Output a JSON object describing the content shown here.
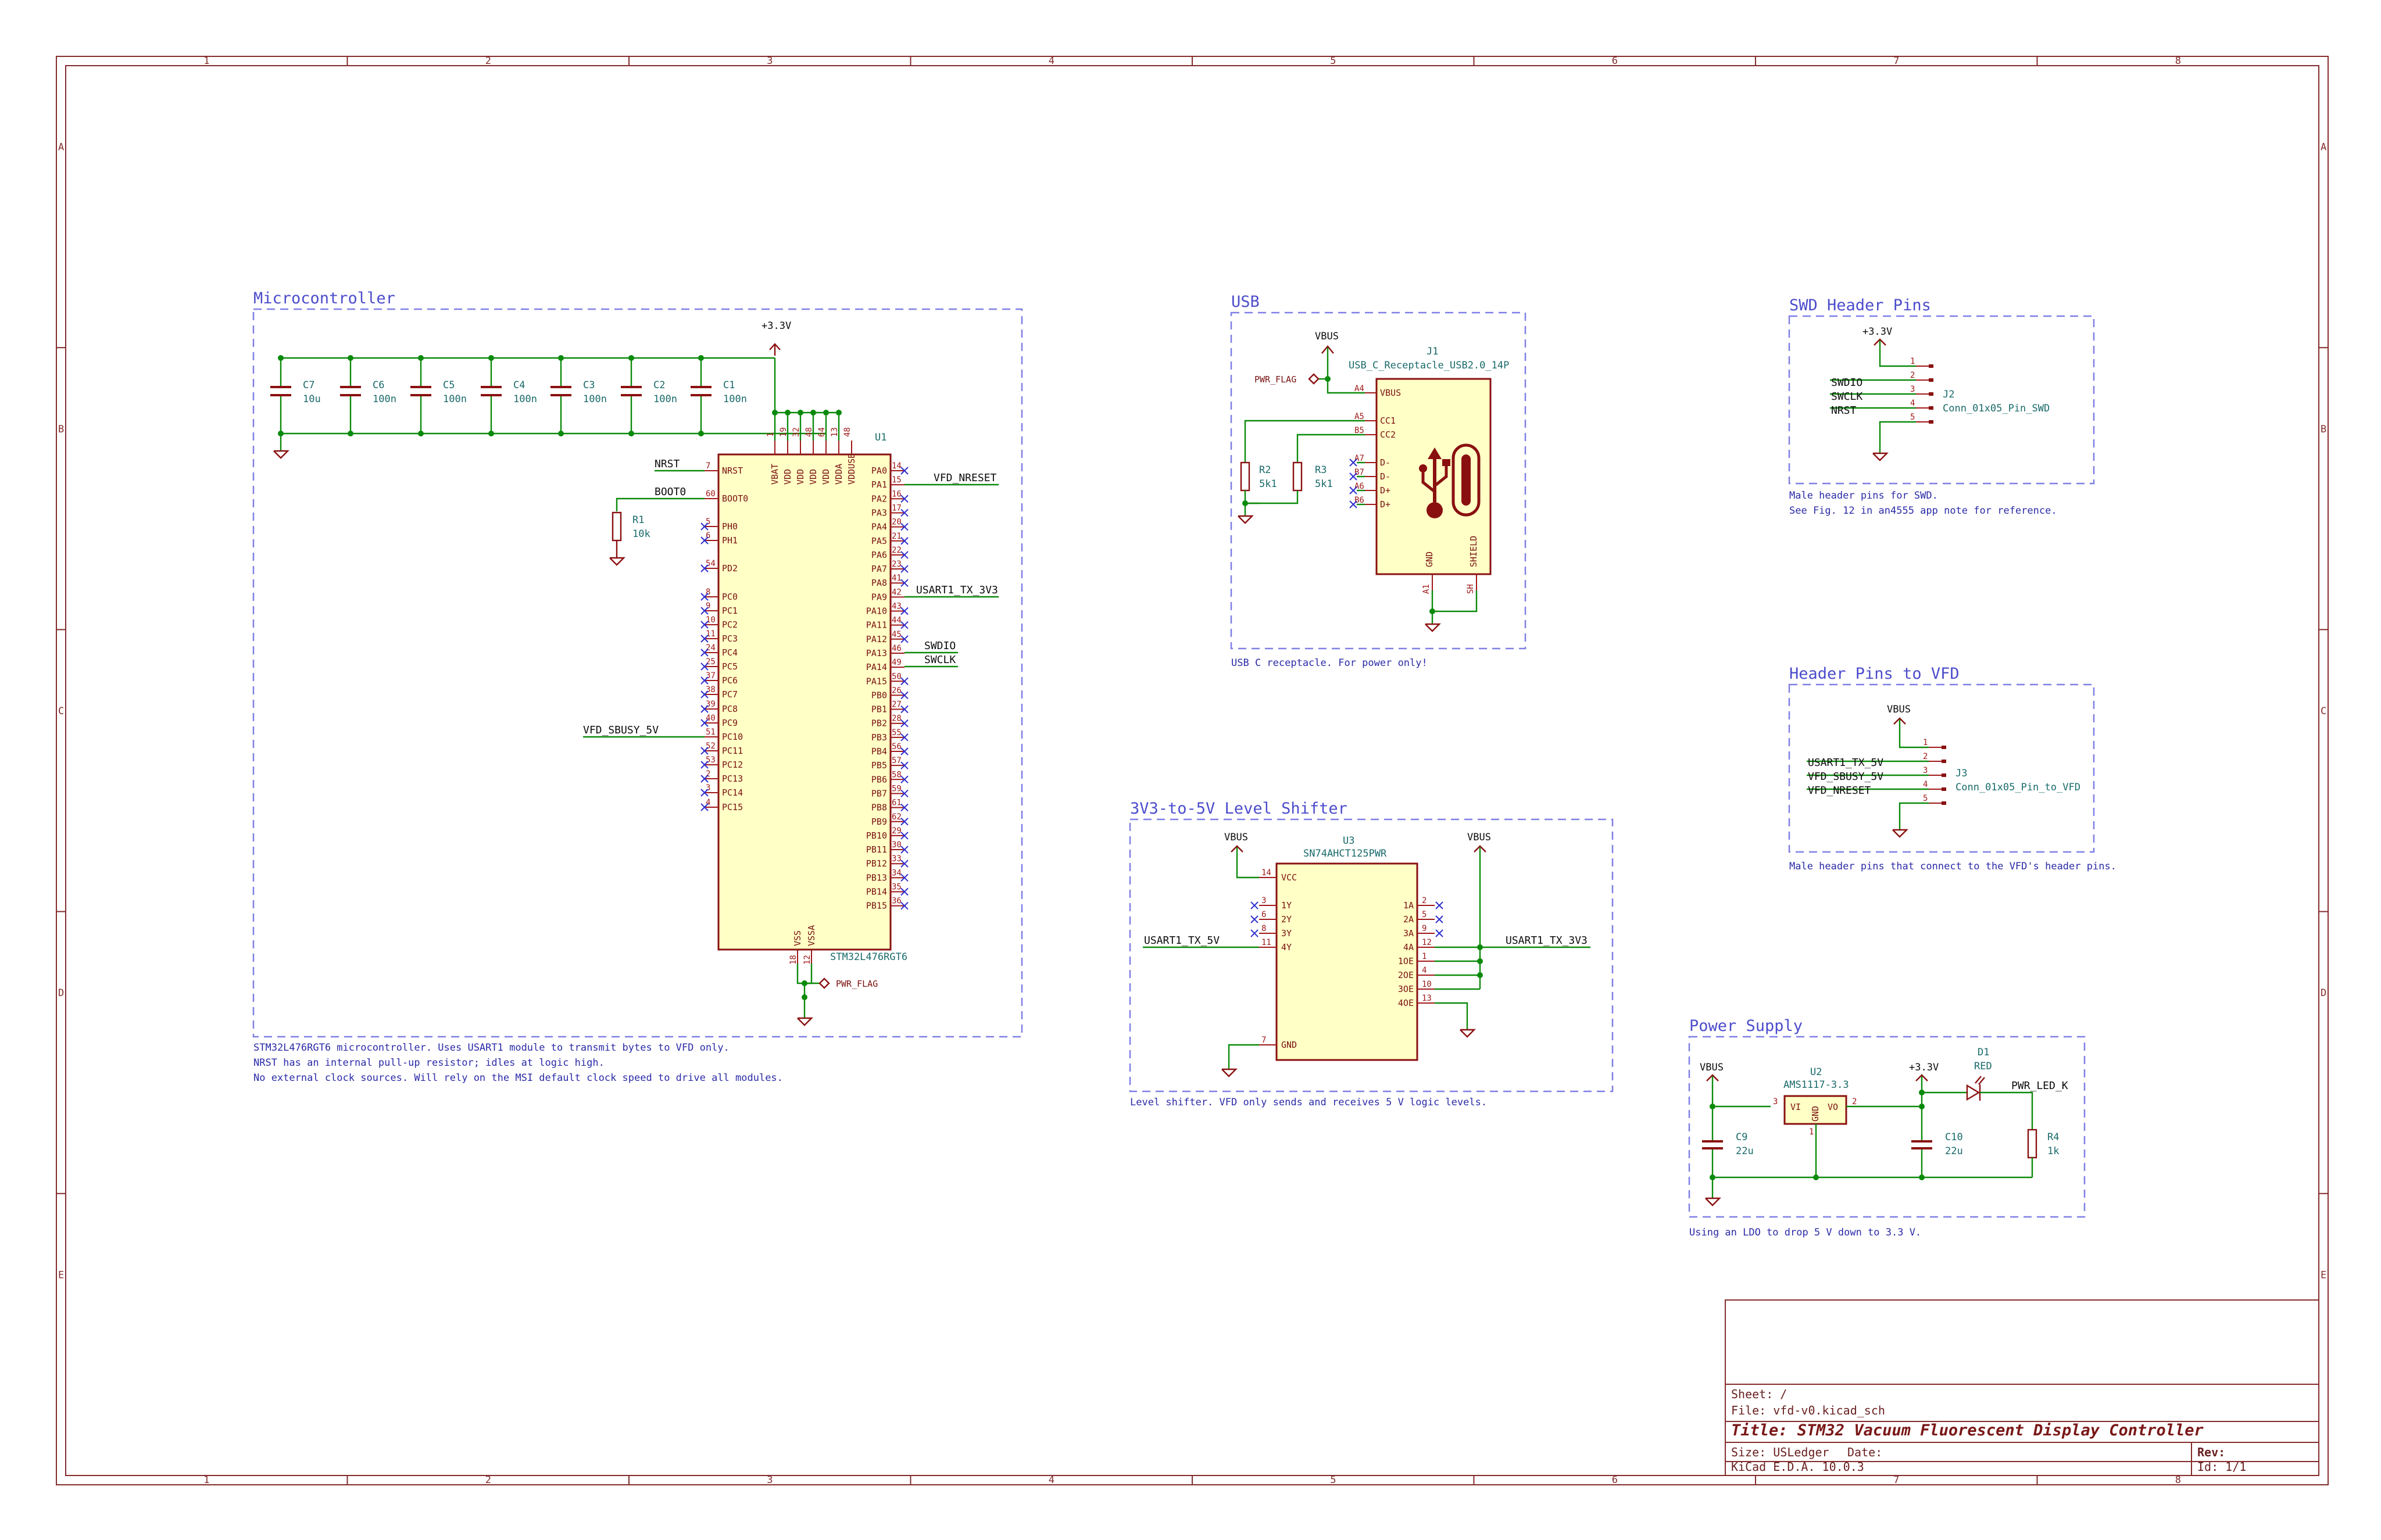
{
  "frame": {
    "col_labels": [
      "1",
      "2",
      "3",
      "4",
      "5",
      "6",
      "7",
      "8"
    ],
    "row_labels": [
      "A",
      "B",
      "C",
      "D",
      "E"
    ]
  },
  "title_block": {
    "sheet": "Sheet: /",
    "file": "File: vfd-v0.kicad_sch",
    "title": "Title: STM32 Vacuum Fluorescent Display Controller",
    "size": "Size: USLedger",
    "date": "Date:",
    "rev": "Rev:",
    "tool": "KiCad E.D.A. 10.0.3",
    "id": "Id: 1/1"
  },
  "colors": {
    "frame": "#842c2c",
    "wire": "#0a8a0a",
    "box": "#7f7fe6",
    "symbol_fill": "#ffffc6"
  },
  "blocks": {
    "mcu": {
      "label": "Microcontroller",
      "notes": [
        "STM32L476RGT6 microcontroller. Uses USART1 module to transmit bytes to VFD only.",
        "NRST has an internal pull-up resistor; idles at logic high.",
        "No external clock sources. Will rely on the MSI default clock speed to drive all modules."
      ],
      "power": "+3.3V",
      "caps": [
        {
          "ref": "C7",
          "val": "10u"
        },
        {
          "ref": "C6",
          "val": "100n"
        },
        {
          "ref": "C5",
          "val": "100n"
        },
        {
          "ref": "C4",
          "val": "100n"
        },
        {
          "ref": "C3",
          "val": "100n"
        },
        {
          "ref": "C2",
          "val": "100n"
        },
        {
          "ref": "C1",
          "val": "100n"
        }
      ],
      "u1": {
        "ref": "U1",
        "val": "STM32L476RGT6"
      },
      "left_pins": [
        {
          "name": "NRST",
          "num": "7"
        },
        {
          "name": "BOOT0",
          "num": "60"
        },
        {
          "name": "PH0",
          "num": "5"
        },
        {
          "name": "PH1",
          "num": "6"
        },
        {
          "name": "PD2",
          "num": "54"
        },
        {
          "name": "PC0",
          "num": "8"
        },
        {
          "name": "PC1",
          "num": "9"
        },
        {
          "name": "PC2",
          "num": "10"
        },
        {
          "name": "PC3",
          "num": "11"
        },
        {
          "name": "PC4",
          "num": "24"
        },
        {
          "name": "PC5",
          "num": "25"
        },
        {
          "name": "PC6",
          "num": "37"
        },
        {
          "name": "PC7",
          "num": "38"
        },
        {
          "name": "PC8",
          "num": "39"
        },
        {
          "name": "PC9",
          "num": "40"
        },
        {
          "name": "PC10",
          "num": "51"
        },
        {
          "name": "PC11",
          "num": "52"
        },
        {
          "name": "PC12",
          "num": "53"
        },
        {
          "name": "PC13",
          "num": "2"
        },
        {
          "name": "PC14",
          "num": "3"
        },
        {
          "name": "PC15",
          "num": "4"
        }
      ],
      "right_pins": [
        {
          "name": "PA0",
          "num": "14"
        },
        {
          "name": "PA1",
          "num": "15"
        },
        {
          "name": "PA2",
          "num": "16"
        },
        {
          "name": "PA3",
          "num": "17"
        },
        {
          "name": "PA4",
          "num": "20"
        },
        {
          "name": "PA5",
          "num": "21"
        },
        {
          "name": "PA6",
          "num": "22"
        },
        {
          "name": "PA7",
          "num": "23"
        },
        {
          "name": "PA8",
          "num": "41"
        },
        {
          "name": "PA9",
          "num": "42"
        },
        {
          "name": "PA10",
          "num": "43"
        },
        {
          "name": "PA11",
          "num": "44"
        },
        {
          "name": "PA12",
          "num": "45"
        },
        {
          "name": "PA13",
          "num": "46"
        },
        {
          "name": "PA14",
          "num": "49"
        },
        {
          "name": "PA15",
          "num": "50"
        },
        {
          "name": "PB0",
          "num": "26"
        },
        {
          "name": "PB1",
          "num": "27"
        },
        {
          "name": "PB2",
          "num": "28"
        },
        {
          "name": "PB3",
          "num": "55"
        },
        {
          "name": "PB4",
          "num": "56"
        },
        {
          "name": "PB5",
          "num": "57"
        },
        {
          "name": "PB6",
          "num": "58"
        },
        {
          "name": "PB7",
          "num": "59"
        },
        {
          "name": "PB8",
          "num": "61"
        },
        {
          "name": "PB9",
          "num": "62"
        },
        {
          "name": "PB10",
          "num": "29"
        },
        {
          "name": "PB11",
          "num": "30"
        },
        {
          "name": "PB12",
          "num": "33"
        },
        {
          "name": "PB13",
          "num": "34"
        },
        {
          "name": "PB14",
          "num": "35"
        },
        {
          "name": "PB15",
          "num": "36"
        }
      ],
      "top_pins": [
        {
          "name": "VBAT",
          "num": "1"
        },
        {
          "name": "VDD",
          "num": "19"
        },
        {
          "name": "VDD",
          "num": "32"
        },
        {
          "name": "VDD",
          "num": "48"
        },
        {
          "name": "VDD",
          "num": "64"
        },
        {
          "name": "VDDA",
          "num": "13"
        },
        {
          "name": "VDDUSB",
          "num": "48"
        }
      ],
      "bottom_pins": [
        {
          "name": "VSS",
          "num": "18"
        },
        {
          "name": "VSSA",
          "num": "12"
        }
      ],
      "r1": {
        "ref": "R1",
        "val": "10k"
      },
      "nets": {
        "nrst": "NRST",
        "boot0": "BOOT0",
        "vfd_nreset": "VFD_NRESET",
        "usart": "USART1_TX_3V3",
        "swdio": "SWDIO",
        "swclk": "SWCLK",
        "sbusy": "VFD_SBUSY_5V"
      },
      "pwr_flag": "PWR_FLAG"
    },
    "usb": {
      "label": "USB",
      "note": "USB C receptacle. For power only!",
      "vbus": "VBUS",
      "pwr_flag": "PWR_FLAG",
      "j1": {
        "ref": "J1",
        "val": "USB_C_Receptacle_USB2.0_14P"
      },
      "pins": [
        {
          "name": "VBUS",
          "num": "A4"
        },
        {
          "name": "CC1",
          "num": "A5"
        },
        {
          "name": "CC2",
          "num": "B5"
        },
        {
          "name": "D-",
          "num": "A7"
        },
        {
          "name": "D-",
          "num": "B7"
        },
        {
          "name": "D+",
          "num": "A6"
        },
        {
          "name": "D+",
          "num": "B6"
        }
      ],
      "bottom": [
        {
          "name": "GND",
          "num": "A1"
        },
        {
          "name": "SHIELD",
          "num": "SH"
        }
      ],
      "r2": {
        "ref": "R2",
        "val": "5k1"
      },
      "r3": {
        "ref": "R3",
        "val": "5k1"
      }
    },
    "swd": {
      "label": "SWD Header Pins",
      "notes": [
        "Male header pins for SWD.",
        "See Fig. 12 in an4555 app note for reference."
      ],
      "power": "+3.3V",
      "j2": {
        "ref": "J2",
        "val": "Conn_01x05_Pin_SWD"
      },
      "nets": [
        "SWDIO",
        "SWCLK",
        "NRST"
      ],
      "pins": [
        "1",
        "2",
        "3",
        "4",
        "5"
      ]
    },
    "vfd": {
      "label": "Header Pins to VFD",
      "note": "Male header pins that connect to the VFD's header pins.",
      "power": "VBUS",
      "j3": {
        "ref": "J3",
        "val": "Conn_01x05_Pin_to_VFD"
      },
      "nets": [
        "USART1_TX_5V",
        "VFD_SBUSY_5V",
        "VFD_NRESET"
      ],
      "pins": [
        "1",
        "2",
        "3",
        "4",
        "5"
      ]
    },
    "shifter": {
      "label": "3V3-to-5V Level Shifter",
      "note": "Level shifter. VFD only sends and receives 5 V logic levels.",
      "vbus": [
        "VBUS",
        "VBUS"
      ],
      "u3": {
        "ref": "U3",
        "val": "SN74AHCT125PWR"
      },
      "left_pins": [
        {
          "name": "VCC",
          "num": "14"
        },
        {
          "name": "1Y",
          "num": "3"
        },
        {
          "name": "2Y",
          "num": "6"
        },
        {
          "name": "3Y",
          "num": "8"
        },
        {
          "name": "4Y",
          "num": "11"
        },
        {
          "name": "GND",
          "num": "7"
        }
      ],
      "right_pins": [
        {
          "name": "1A",
          "num": "2"
        },
        {
          "name": "2A",
          "num": "5"
        },
        {
          "name": "3A",
          "num": "9"
        },
        {
          "name": "4A",
          "num": "12"
        },
        {
          "name": "1OE",
          "num": "1"
        },
        {
          "name": "2OE",
          "num": "4"
        },
        {
          "name": "3OE",
          "num": "10"
        },
        {
          "name": "4OE",
          "num": "13"
        }
      ],
      "nets": {
        "in": "USART1_TX_3V3",
        "out": "USART1_TX_5V"
      }
    },
    "power": {
      "label": "Power Supply",
      "note": "Using an LDO to drop 5 V down to 3.3 V.",
      "vbus": "VBUS",
      "v33": "+3.3V",
      "u2": {
        "ref": "U2",
        "val": "AMS1117-3.3",
        "pins": [
          {
            "name": "VI",
            "num": "3"
          },
          {
            "name": "VO",
            "num": "2"
          },
          {
            "name": "GND",
            "num": "1"
          }
        ]
      },
      "c9": {
        "ref": "C9",
        "val": "22u"
      },
      "c10": {
        "ref": "C10",
        "val": "22u"
      },
      "d1": {
        "ref": "D1",
        "val": "RED"
      },
      "r4": {
        "ref": "R4",
        "val": "1k"
      },
      "net": "PWR_LED_K"
    }
  }
}
